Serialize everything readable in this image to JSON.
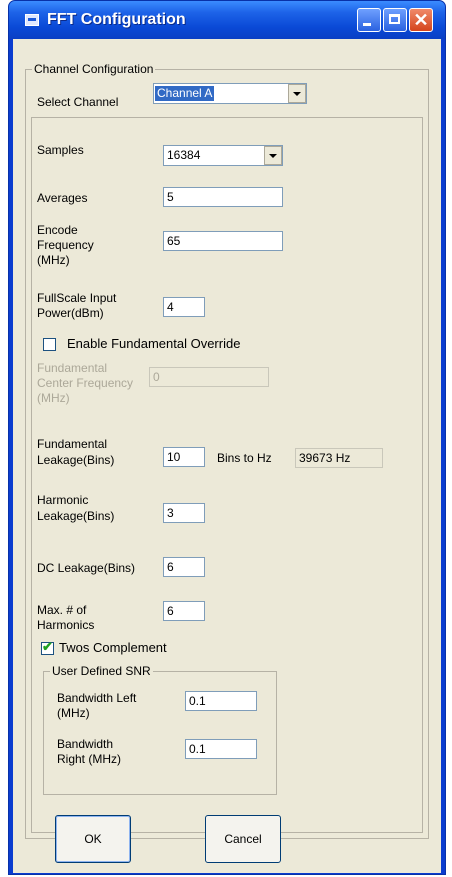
{
  "window": {
    "title": "FFT Configuration",
    "titlebar_color": "#0a49d6"
  },
  "channel_config": {
    "legend": "Channel Configuration",
    "select_label": "Select Channel",
    "select_value": "Channel A"
  },
  "fields": {
    "samples_label": "Samples",
    "samples_value": "16384",
    "averages_label": "Averages",
    "averages_value": "5",
    "encode_label_1": "Encode",
    "encode_label_2": "Frequency",
    "encode_label_3": "(MHz)",
    "encode_value": "65",
    "fullscale_label_1": "FullScale Input",
    "fullscale_label_2": "Power(dBm)",
    "fullscale_value": "4",
    "fund_override_label": "Enable Fundamental Override",
    "fund_override_checked": false,
    "fund_center_label_1": "Fundamental",
    "fund_center_label_2": "Center Frequency",
    "fund_center_label_3": "(MHz)",
    "fund_center_value": "0",
    "fund_leak_label_1": "Fundamental",
    "fund_leak_label_2": "Leakage(Bins)",
    "fund_leak_value": "10",
    "bins_to_hz_label": "Bins to Hz",
    "bins_to_hz_value": "39673 Hz",
    "harm_leak_label_1": "Harmonic",
    "harm_leak_label_2": "Leakage(Bins)",
    "harm_leak_value": "3",
    "dc_leak_label": "DC Leakage(Bins)",
    "dc_leak_value": "6",
    "max_harm_label_1": "Max. # of",
    "max_harm_label_2": "Harmonics",
    "max_harm_value": "6",
    "twos_label": "Twos Complement",
    "twos_checked": true
  },
  "snr": {
    "legend": "User Defined SNR",
    "bw_left_label_1": "Bandwidth Left",
    "bw_left_label_2": "(MHz)",
    "bw_left_value": "0.1",
    "bw_right_label_1": "Bandwidth",
    "bw_right_label_2": "Right (MHz)",
    "bw_right_value": "0.1"
  },
  "buttons": {
    "ok": "OK",
    "cancel": "Cancel"
  }
}
